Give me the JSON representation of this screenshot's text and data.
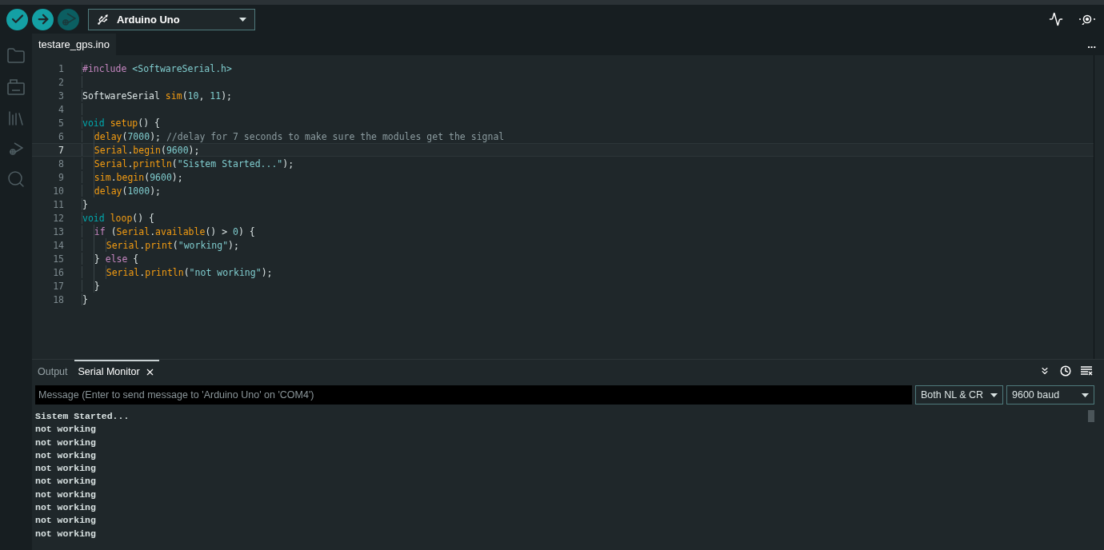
{
  "toolbar": {
    "buttons": [
      {
        "kind": "verify",
        "disabled": false
      },
      {
        "kind": "upload",
        "disabled": false
      },
      {
        "kind": "debug",
        "disabled": true
      }
    ],
    "board": "Arduino Uno"
  },
  "editor": {
    "tab": "testare_gps.ino",
    "more": "...",
    "lines": [
      {
        "number": "1",
        "current": false,
        "tokens": [
          {
            "kind": "directive",
            "text": "#include "
          },
          {
            "kind": "string",
            "text": "<SoftwareSerial.h>"
          }
        ]
      },
      {
        "number": "2",
        "current": false
      },
      {
        "number": "3",
        "current": false,
        "tokens": [
          {
            "kind": "plain",
            "text": "SoftwareSerial "
          },
          {
            "kind": "func",
            "text": "sim"
          },
          {
            "kind": "plain",
            "text": "("
          },
          {
            "kind": "number",
            "text": "10"
          },
          {
            "kind": "plain",
            "text": ", "
          },
          {
            "kind": "number",
            "text": "11"
          },
          {
            "kind": "plain",
            "text": ");"
          }
        ]
      },
      {
        "number": "4",
        "current": false
      },
      {
        "number": "5",
        "current": false,
        "tokens": [
          {
            "kind": "keyword",
            "text": "void "
          },
          {
            "kind": "func",
            "text": "setup"
          },
          {
            "kind": "plain",
            "text": "() {"
          }
        ]
      },
      {
        "number": "6",
        "current": false,
        "tokens": [
          {
            "kind": "func",
            "text": "  delay"
          },
          {
            "kind": "plain",
            "text": "("
          },
          {
            "kind": "number",
            "text": "7000"
          },
          {
            "kind": "plain",
            "text": "); "
          },
          {
            "kind": "comment",
            "text": "//delay for 7 seconds to make sure the modules get the signal"
          }
        ]
      },
      {
        "number": "7",
        "current": true,
        "tokens": [
          {
            "kind": "func",
            "text": "  Serial"
          },
          {
            "kind": "plain",
            "text": "."
          },
          {
            "kind": "func",
            "text": "begin"
          },
          {
            "kind": "plain",
            "text": "("
          },
          {
            "kind": "number",
            "text": "9600"
          },
          {
            "kind": "plain",
            "text": ");"
          }
        ]
      },
      {
        "number": "8",
        "current": false,
        "tokens": [
          {
            "kind": "func",
            "text": "  Serial"
          },
          {
            "kind": "plain",
            "text": "."
          },
          {
            "kind": "func",
            "text": "println"
          },
          {
            "kind": "plain",
            "text": "("
          },
          {
            "kind": "string",
            "text": "\"Sistem Started...\""
          },
          {
            "kind": "plain",
            "text": ");"
          }
        ]
      },
      {
        "number": "9",
        "current": false,
        "tokens": [
          {
            "kind": "func",
            "text": "  sim"
          },
          {
            "kind": "plain",
            "text": "."
          },
          {
            "kind": "func",
            "text": "begin"
          },
          {
            "kind": "plain",
            "text": "("
          },
          {
            "kind": "number",
            "text": "9600"
          },
          {
            "kind": "plain",
            "text": ");"
          }
        ]
      },
      {
        "number": "10",
        "current": false,
        "tokens": [
          {
            "kind": "func",
            "text": "  delay"
          },
          {
            "kind": "plain",
            "text": "("
          },
          {
            "kind": "number",
            "text": "1000"
          },
          {
            "kind": "plain",
            "text": ");"
          }
        ]
      },
      {
        "number": "11",
        "current": false,
        "tokens": [
          {
            "kind": "plain",
            "text": "}"
          }
        ]
      },
      {
        "number": "12",
        "current": false,
        "tokens": [
          {
            "kind": "keyword",
            "text": "void "
          },
          {
            "kind": "func",
            "text": "loop"
          },
          {
            "kind": "plain",
            "text": "() {"
          }
        ]
      },
      {
        "number": "13",
        "current": false,
        "tokens": [
          {
            "kind": "control",
            "text": "  if"
          },
          {
            "kind": "plain",
            "text": " ("
          },
          {
            "kind": "func",
            "text": "Serial"
          },
          {
            "kind": "plain",
            "text": "."
          },
          {
            "kind": "func",
            "text": "available"
          },
          {
            "kind": "plain",
            "text": "() > "
          },
          {
            "kind": "number",
            "text": "0"
          },
          {
            "kind": "plain",
            "text": ") {"
          }
        ]
      },
      {
        "number": "14",
        "current": false,
        "tokens": [
          {
            "kind": "func",
            "text": "    Serial"
          },
          {
            "kind": "plain",
            "text": "."
          },
          {
            "kind": "func",
            "text": "print"
          },
          {
            "kind": "plain",
            "text": "("
          },
          {
            "kind": "string",
            "text": "\"working\""
          },
          {
            "kind": "plain",
            "text": ");"
          }
        ]
      },
      {
        "number": "15",
        "current": false,
        "tokens": [
          {
            "kind": "plain",
            "text": "  } "
          },
          {
            "kind": "control",
            "text": "else"
          },
          {
            "kind": "plain",
            "text": " {"
          }
        ]
      },
      {
        "number": "16",
        "current": false,
        "tokens": [
          {
            "kind": "func",
            "text": "    Serial"
          },
          {
            "kind": "plain",
            "text": "."
          },
          {
            "kind": "func",
            "text": "println"
          },
          {
            "kind": "plain",
            "text": "("
          },
          {
            "kind": "string",
            "text": "\"not working\""
          },
          {
            "kind": "plain",
            "text": ");"
          }
        ]
      },
      {
        "number": "17",
        "current": false,
        "tokens": [
          {
            "kind": "plain",
            "text": "  }"
          }
        ]
      },
      {
        "number": "18",
        "current": false,
        "tokens": [
          {
            "kind": "plain",
            "text": "}"
          }
        ]
      }
    ]
  },
  "panel": {
    "tabs": [
      {
        "label": "Output",
        "selected": false,
        "closable": false
      },
      {
        "label": "Serial Monitor",
        "selected": true,
        "closable": true
      }
    ],
    "message_placeholder": "Message (Enter to send message to 'Arduino Uno' on 'COM4')",
    "line_ending": "Both NL & CR",
    "baud": "9600 baud",
    "output": [
      "Sistem Started...",
      "not working",
      "not working",
      "not working",
      "not working",
      "not working",
      "not working",
      "not working",
      "not working",
      "not working"
    ]
  }
}
